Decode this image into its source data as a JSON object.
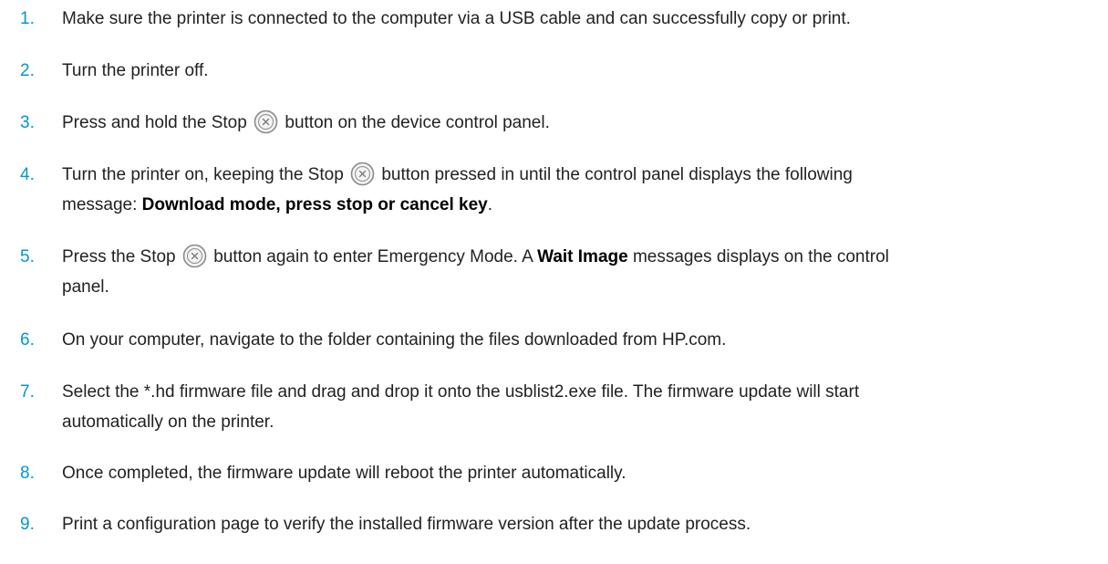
{
  "colors": {
    "step_number": "#0096d6",
    "body_text": "#231f20"
  },
  "icons": {
    "stop": "stop-x-circle-icon"
  },
  "steps": [
    {
      "number": "1.",
      "text": "Make sure the printer is connected to the computer via a USB cable and can successfully copy or print."
    },
    {
      "number": "2.",
      "text": "Turn the printer off."
    },
    {
      "number": "3.",
      "pre": "Press and hold the Stop",
      "post": "button on the device control panel."
    },
    {
      "number": "4.",
      "pre": "Turn the printer on, keeping the Stop",
      "post": "button pressed in until the control panel displays the following",
      "line2_pre": "message: ",
      "line2_bold": "Download mode, press stop or cancel key",
      "line2_post": "."
    },
    {
      "number": "5.",
      "pre": "Press the Stop",
      "post": "button again to enter Emergency Mode. A ",
      "bold": "Wait Image",
      "post2": " messages displays on the control",
      "line2": "panel."
    },
    {
      "number": "6.",
      "text": "On your computer, navigate to the folder containing the files downloaded from HP.com."
    },
    {
      "number": "7.",
      "text": "Select the *.hd firmware file and drag and drop it onto the usblist2.exe file. The firmware update will start",
      "line2": "automatically on the printer."
    },
    {
      "number": "8.",
      "text": "Once completed, the firmware update will reboot the printer automatically."
    },
    {
      "number": "9.",
      "text": "Print a configuration page to verify the installed firmware version after the update process."
    }
  ]
}
